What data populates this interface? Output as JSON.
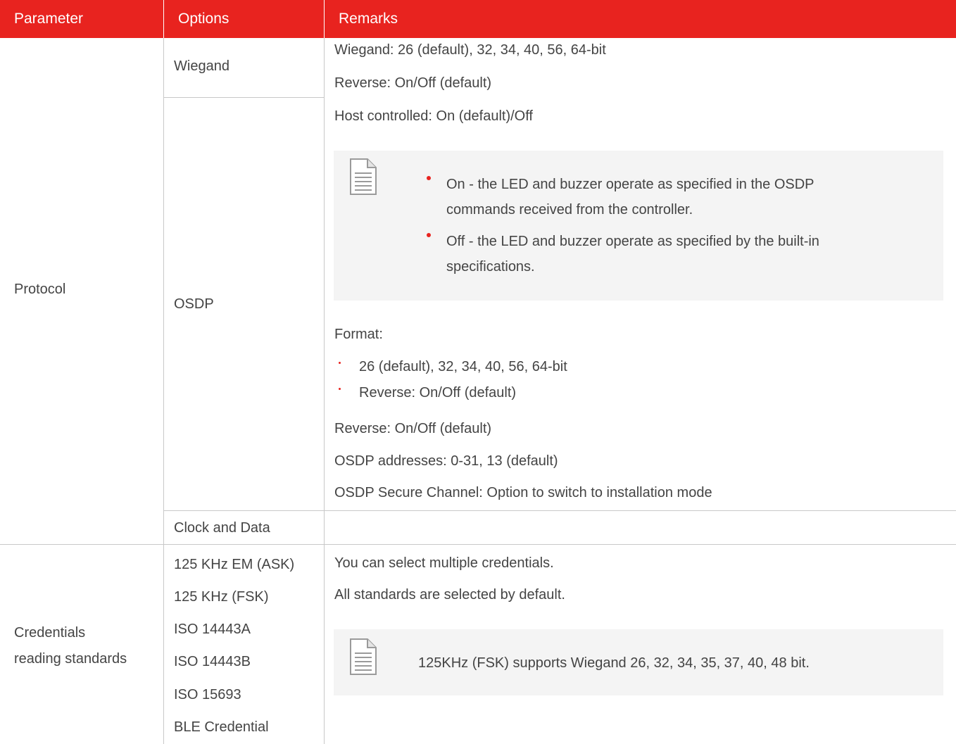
{
  "header": {
    "col_parameter": "Parameter",
    "col_options": "Options",
    "col_remarks": "Remarks"
  },
  "rows": {
    "protocol": {
      "parameter": "Protocol",
      "wiegand": {
        "option": "Wiegand",
        "remarks": [
          "Wiegand: 26 (default), 32, 34, 40, 56, 64-bit",
          "Reverse: On/Off (default)"
        ]
      },
      "osdp": {
        "option": "OSDP",
        "host_controlled": "Host controlled: On (default)/Off",
        "note_items": [
          "On - the LED and buzzer operate as specified in the OSDP",
          "commands received from the controller.",
          "Off - the LED and buzzer operate as specified by the built-in",
          "specifications."
        ],
        "format_label": "Format:",
        "format_items": [
          "26 (default), 32, 34, 40, 56, 64-bit",
          "Reverse: On/Off (default)"
        ],
        "extra": [
          "Reverse: On/Off (default)",
          "OSDP addresses: 0-31, 13 (default)",
          "OSDP Secure Channel: Option to switch to installation mode"
        ]
      },
      "clock_data": {
        "option": "Clock and Data"
      }
    },
    "credentials": {
      "parameter_line1": "Credentials",
      "parameter_line2": "reading standards",
      "options": [
        "125 KHz EM (ASK)",
        "125 KHz (FSK)",
        "ISO 14443A",
        "ISO 14443B",
        "ISO 15693",
        "BLE Credential"
      ],
      "remarks": [
        "You can select multiple credentials.",
        "All standards are selected by default."
      ],
      "note": "125KHz (FSK) supports Wiegand 26, 32, 34, 35, 37, 40, 48 bit."
    }
  },
  "colors": {
    "accent": "#e8231f",
    "note_bg": "#f4f4f4",
    "rule": "#c8c8c8"
  }
}
